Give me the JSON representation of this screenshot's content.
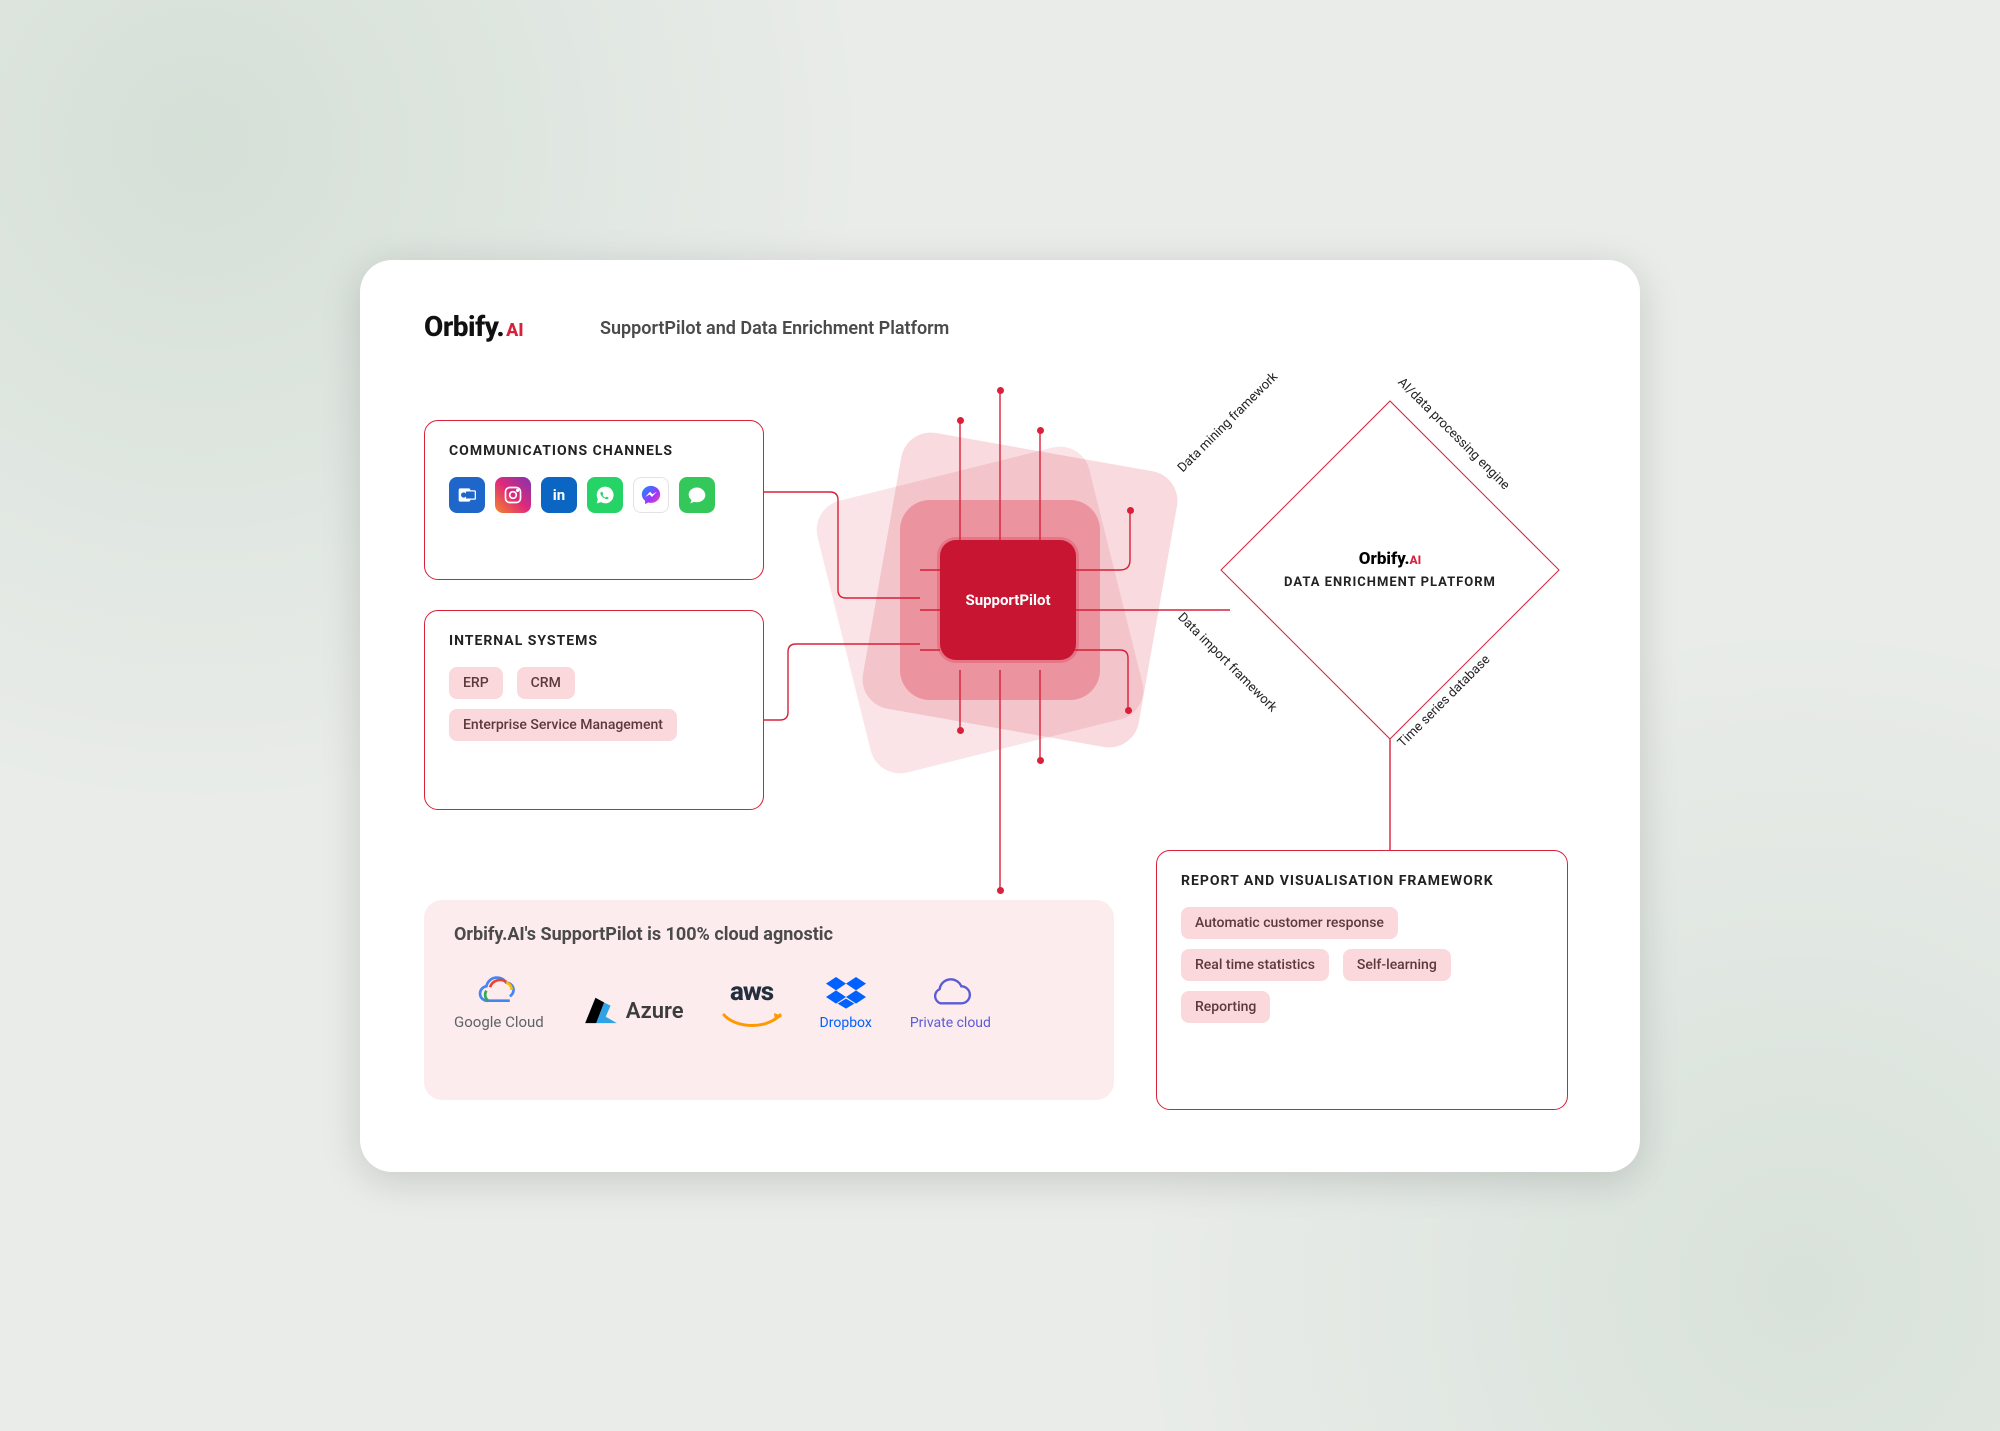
{
  "header": {
    "logo_text": "Orbify.",
    "logo_suffix": "AI",
    "title": "SupportPilot and Data Enrichment Platform"
  },
  "panels": {
    "communications": {
      "title": "COMMUNICATIONS CHANNELS",
      "icons": [
        {
          "name": "outlook",
          "bg": "#1e66c9",
          "glyph": "✉"
        },
        {
          "name": "instagram",
          "bg": "linear-gradient(45deg,#f58529,#dd2a7b,#8134af)",
          "glyph": "◎"
        },
        {
          "name": "linkedin",
          "bg": "#0a66c2",
          "glyph": "in"
        },
        {
          "name": "whatsapp",
          "bg": "#25d366",
          "glyph": "✆"
        },
        {
          "name": "messenger",
          "bg": "#ffffff",
          "glyph": "✦",
          "fg": "#a033ff"
        },
        {
          "name": "imessage",
          "bg": "#34c759",
          "glyph": "✉"
        }
      ]
    },
    "internal": {
      "title": "INTERNAL SYSTEMS",
      "items": [
        "ERP",
        "CRM",
        "Enterprise Service Management"
      ]
    },
    "report": {
      "title": "REPORT AND VISUALISATION FRAMEWORK",
      "items": [
        "Automatic customer response",
        "Real time statistics",
        "Self-learning",
        "Reporting"
      ]
    }
  },
  "hub": {
    "label": "SupportPilot"
  },
  "diamond": {
    "logo_text": "Orbify.",
    "logo_suffix": "AI",
    "title": "DATA ENRICHMENT PLATFORM",
    "edges": {
      "top_left": "Data mining framework",
      "top_right": "AI/data processing engine",
      "bottom_left": "Data import framework",
      "bottom_right": "Time series database"
    }
  },
  "cloud_banner": {
    "title": "Orbify.AI's SupportPilot is 100% cloud agnostic",
    "providers": [
      "Google Cloud",
      "Azure",
      "aws",
      "Dropbox",
      "Private cloud"
    ]
  }
}
